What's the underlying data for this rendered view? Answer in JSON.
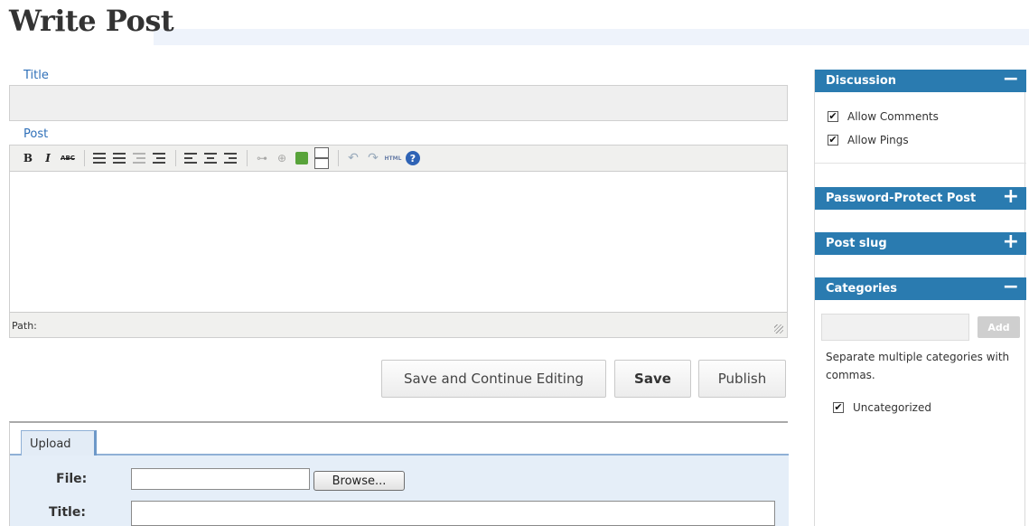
{
  "page": {
    "title": "Write Post"
  },
  "title_field": {
    "label": "Title",
    "value": ""
  },
  "post_field": {
    "label": "Post",
    "path_label": "Path:"
  },
  "toolbar": {
    "bold": "B",
    "italic": "I",
    "strikethrough": "ABC",
    "html": "HTML",
    "help": "?"
  },
  "actions": {
    "save_continue": "Save and Continue Editing",
    "save": "Save",
    "publish": "Publish"
  },
  "upload": {
    "tab_label": "Upload",
    "file_label": "File:",
    "browse_label": "Browse...",
    "title_label": "Title:"
  },
  "sidebar": {
    "discussion": {
      "title": "Discussion",
      "toggle": "−",
      "allow_comments": "Allow Comments",
      "allow_pings": "Allow Pings"
    },
    "password": {
      "title": "Password-Protect Post",
      "toggle": "+"
    },
    "slug": {
      "title": "Post slug",
      "toggle": "+"
    },
    "categories": {
      "title": "Categories",
      "toggle": "−",
      "add_label": "Add",
      "hint": "Separate multiple categories with commas.",
      "items": [
        {
          "label": "Uncategorized",
          "checked": true
        }
      ]
    }
  },
  "colors": {
    "accent": "#2a7bb0",
    "link": "#2e6fb8",
    "upload_bg": "#e5eef8"
  }
}
